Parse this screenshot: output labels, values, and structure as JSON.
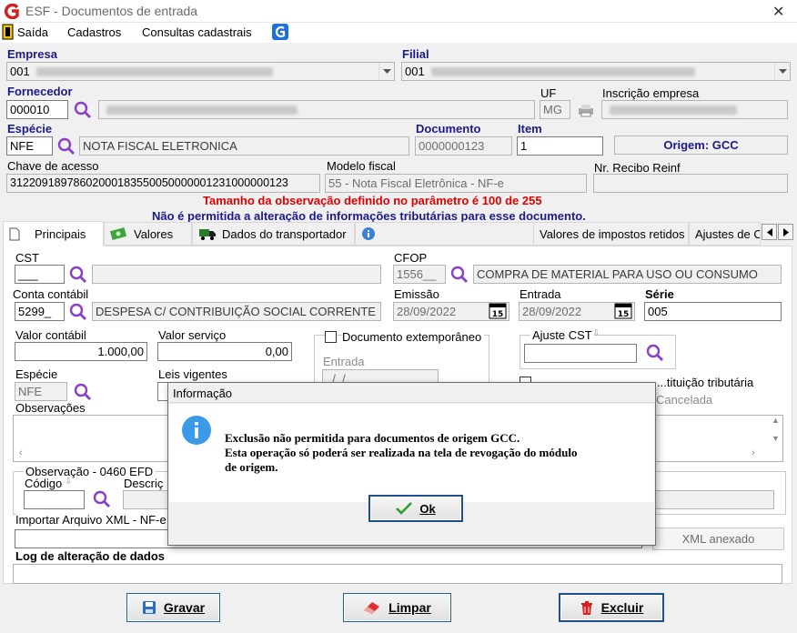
{
  "window": {
    "title": "ESF - Documentos de entrada",
    "close_glyph": "✕"
  },
  "menu": {
    "saida": "Saída",
    "cadastros": "Cadastros",
    "consultas": "Consultas cadastrais"
  },
  "header": {
    "empresa_label": "Empresa",
    "empresa_value": "001",
    "filial_label": "Filial",
    "filial_value": "001",
    "fornecedor_label": "Fornecedor",
    "fornecedor_value": "000010",
    "uf_label": "UF",
    "uf_value": "MG",
    "inscricao_label": "Inscrição empresa",
    "especie_label": "Espécie",
    "especie_value": "NFE",
    "especie_desc": "NOTA FISCAL ELETRONICA",
    "documento_label": "Documento",
    "documento_value": "0000000123",
    "item_label": "Item",
    "item_value": "1",
    "origem": "Origem: GCC",
    "chave_label": "Chave de acesso",
    "chave_value": "31220918978602000183550050000001231000000123",
    "modelo_label": "Modelo fiscal",
    "modelo_value": "55 - Nota Fiscal Eletrônica - NF-e",
    "recibo_label": "Nr. Recibo Reinf"
  },
  "warnings": {
    "obs_size": "Tamanho da observação definido no parâmetro é 100 de 255",
    "tax_info": "Não é permitida a alteração de informações tributárias para esse documento."
  },
  "tabs": {
    "principais": "Principais",
    "valores": "Valores",
    "transportador": "Dados do transportador",
    "impostos": "Valores de impostos retidos",
    "ajustes": "Ajustes de C"
  },
  "principais": {
    "cst_label": "CST",
    "cst_value": "___",
    "cfop_label": "CFOP",
    "cfop_value": "1556__",
    "cfop_desc": "COMPRA DE MATERIAL PARA USO OU CONSUMO",
    "conta_label": "Conta contábil",
    "conta_value": "5299_",
    "conta_desc": "DESPESA C/ CONTRIBUIÇÃO SOCIAL CORRENTE",
    "emissao_label": "Emissão",
    "emissao_value": "28/09/2022",
    "entrada_label": "Entrada",
    "entrada_value": "28/09/2022",
    "serie_label": "Série",
    "serie_value": "005",
    "valor_contabil_label": "Valor contábil",
    "valor_contabil_value": "1.000,00",
    "valor_servico_label": "Valor serviço",
    "valor_servico_value": "0,00",
    "extemp_label": "Documento extemporâneo",
    "extemp_entrada_label": "Entrada",
    "extemp_entrada_value": "_/_/_",
    "ajuste_cst_label": "Ajuste CST",
    "especie_label": "Espécie",
    "especie_value": "NFE",
    "leis_label": "Leis vigentes",
    "subst_label": "...tituição tributária",
    "cancelada_label": "Cancelada",
    "observacoes_label": "Observações",
    "obs_efd_label": "Observação - 0460 EFD",
    "codigo_label": "Código",
    "descricao_label": "Descriç",
    "xml_label": "Importar Arquivo XML - NF-e",
    "xml_anexado": "XML anexado",
    "log_label": "Log de alteração de dados"
  },
  "dialog": {
    "title": "Informação",
    "message_line1": "Exclusão não permitida para documentos de origem GCC.",
    "message_line2": "Esta operação só poderá ser realizada na tela de revogação do módulo",
    "message_line3": "de origem.",
    "ok_label": "Ok"
  },
  "footer": {
    "gravar": "Gravar",
    "limpar": "Limpar",
    "excluir": "Excluir"
  },
  "colors": {
    "warning": "#e00000",
    "accent": "#1a1a8c",
    "info_icon": "#3c9be8"
  }
}
